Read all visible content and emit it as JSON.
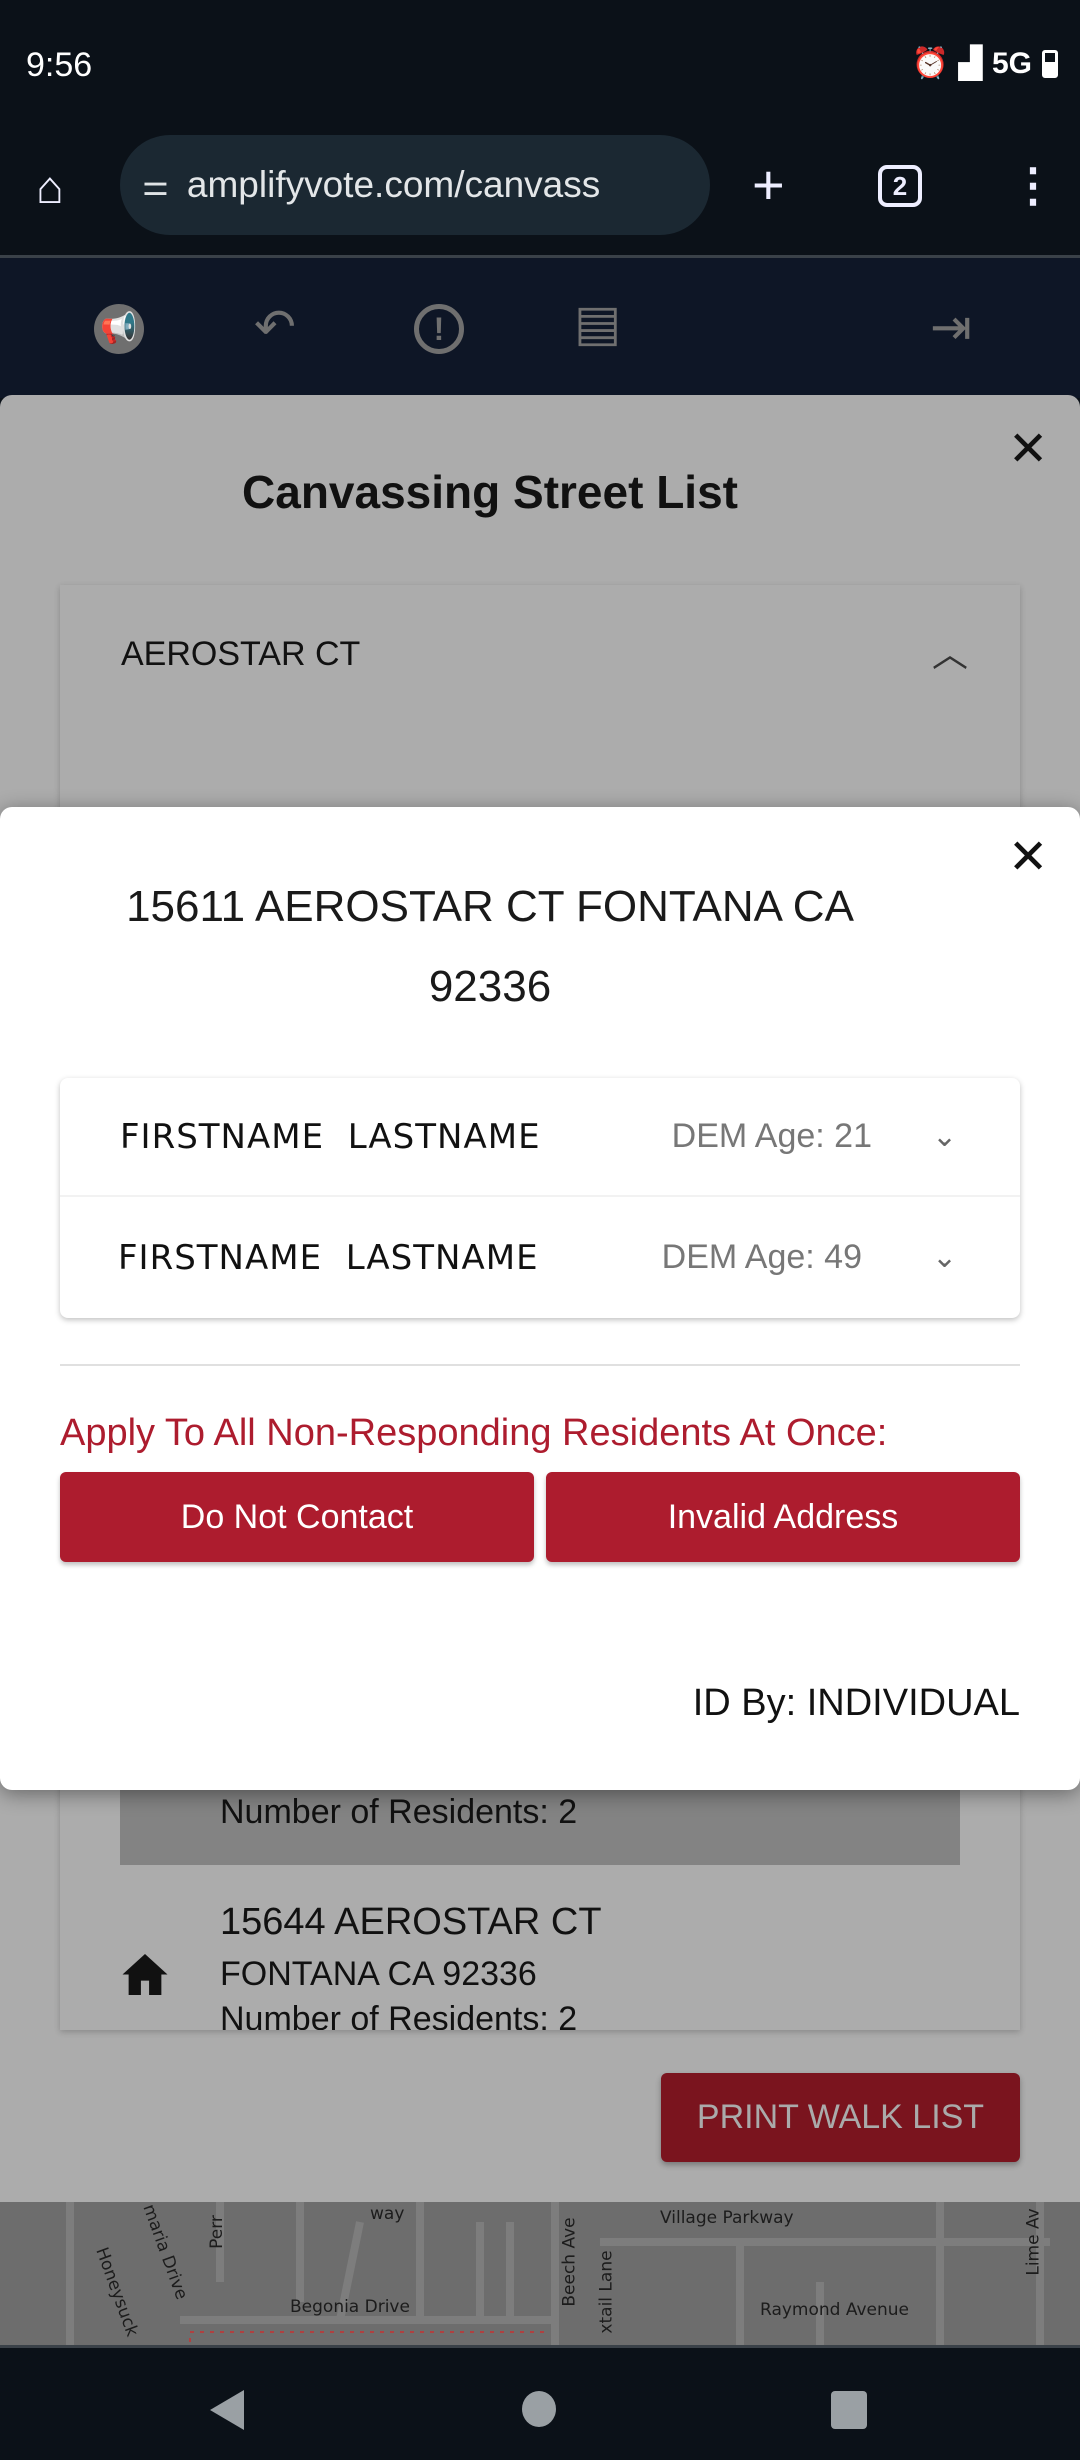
{
  "status_bar": {
    "time": "9:56",
    "network": "5G",
    "icons": [
      "alarm-icon",
      "signal-icon",
      "battery-icon"
    ]
  },
  "browser": {
    "url": "amplifyvote.com/canvass",
    "tab_count": "2"
  },
  "toolbar": {
    "icons": [
      "megaphone-logo-icon",
      "reply-icon",
      "alert-icon",
      "library-icon",
      "logout-icon"
    ]
  },
  "sheet": {
    "title": "Canvassing Street List",
    "street": "AEROSTAR CT",
    "addresses": [
      {
        "residents": "Number of Residents: 2"
      },
      {
        "line1": "15644 AEROSTAR CT",
        "line2": "FONTANA CA 92336",
        "residents": "Number of Residents: 2"
      }
    ],
    "print_label": "PRINT WALK LIST"
  },
  "modal": {
    "address_line1": "15611 AEROSTAR CT FONTANA CA",
    "address_line2": "92336",
    "residents": [
      {
        "first": "FIRSTNAME",
        "last": "LASTNAME",
        "info": "DEM Age: 21"
      },
      {
        "first": "FIRSTNAME",
        "last": "LASTNAME",
        "info": "DEM Age: 49"
      }
    ],
    "apply_label": "Apply To All Non-Responding Residents At Once:",
    "do_not_contact": "Do Not Contact",
    "invalid_address": "Invalid Address",
    "id_by": "ID By: INDIVIDUAL"
  },
  "map": {
    "labels": [
      "way",
      "Village Parkway",
      "maria Drive",
      "Perr",
      "Honeysuck",
      "Begonia Drive",
      "Beech Ave",
      "xtail Lane",
      "Raymond Avenue",
      "Lime Av"
    ]
  },
  "colors": {
    "accent": "#ad1c2e",
    "print_button": "#7a141e",
    "overlay": "#acacac"
  }
}
